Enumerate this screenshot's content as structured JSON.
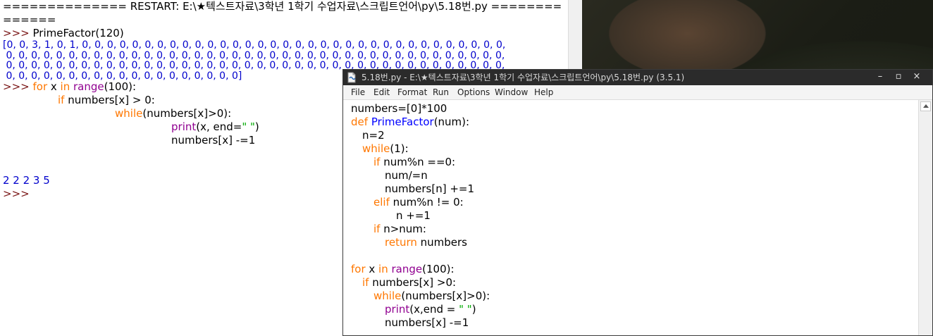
{
  "shell": {
    "restart_line": "============== RESTART: E:\\★텍스트자료\\3학년 1학기 수업자료\\스크립트언어\\py\\5.18번.py ========",
    "restart_tail": "======",
    "prompt": ">>>",
    "call": "PrimeFactor(120)",
    "list_output": [
      "[0, 0, 3, 1, 0, 1, 0, 0, 0, 0, 0, 0, 0, 0, 0, 0, 0, 0, 0, 0, 0, 0, 0, 0, 0, 0, 0, 0, 0, 0, 0, 0, 0, 0, 0, 0, 0, 0, 0, 0,",
      " 0, 0, 0, 0, 0, 0, 0, 0, 0, 0, 0, 0, 0, 0, 0, 0, 0, 0, 0, 0, 0, 0, 0, 0, 0, 0, 0, 0, 0, 0, 0, 0, 0, 0, 0, 0, 0, 0, 0, 0,",
      " 0, 0, 0, 0, 0, 0, 0, 0, 0, 0, 0, 0, 0, 0, 0, 0, 0, 0, 0, 0, 0, 0, 0, 0, 0, 0, 0, 0, 0, 0, 0, 0, 0, 0, 0, 0, 0, 0, 0, 0,",
      " 0, 0, 0, 0, 0, 0, 0, 0, 0, 0, 0, 0, 0, 0, 0, 0, 0, 0, 0]"
    ],
    "for_kw": "for",
    "for_rest_a": " x ",
    "in_kw": "in",
    "range_bi": "range",
    "for_rest_b": "(100):",
    "if_kw": "if",
    "if_rest": " numbers[x] > 0:",
    "while_kw": "while",
    "while_rest": "(numbers[x]>0):",
    "print_bi": "print",
    "print_rest_a": "(x, end=",
    "print_str": "\" \"",
    "print_rest_b": ")",
    "decrement": "numbers[x] -=1",
    "result_output": "2 2 2 3 5"
  },
  "editor": {
    "title": "5.18번.py - E:\\★텍스트자료\\3학년 1학기 수업자료\\스크립트언어\\py\\5.18번.py (3.5.1)",
    "window_buttons": {
      "minimize": "–",
      "maximize": "▫",
      "close": "×"
    },
    "menu": [
      "File",
      "Edit",
      "Format",
      "Run",
      "Options",
      "Window",
      "Help"
    ],
    "code": {
      "l1": "numbers=[0]*100",
      "l2_kw": "def",
      "l2_fn": "PrimeFactor",
      "l2_rest": "(num):",
      "l3": "n=2",
      "l4_kw": "while",
      "l4_rest": "(1):",
      "l5_kw": "if",
      "l5_rest": " num%n ==0:",
      "l6": "num/=n",
      "l7": "numbers[n] +=1",
      "l8_kw": "elif",
      "l8_rest": " num%n != 0:",
      "l9": "n +=1",
      "l10_kw": "if",
      "l10_rest": " n>num:",
      "l11_kw": "return",
      "l11_rest": " numbers",
      "l12_kw": "for",
      "l12_a": " x ",
      "l12_in": "in",
      "l12_sp": " ",
      "l12_bi": "range",
      "l12_rest": "(100):",
      "l13_kw": "if",
      "l13_rest": " numbers[x] >0:",
      "l14_kw": "while",
      "l14_rest": "(numbers[x]>0):",
      "l15_bi": "print",
      "l15_a": "(x,end = ",
      "l15_str": "\" \"",
      "l15_b": ")",
      "l16": "numbers[x] -=1"
    }
  },
  "colors": {
    "keyword": "#ff7700",
    "builtin": "#900090",
    "string": "#00aa00",
    "output": "#0000cc",
    "prompt": "#7a1616",
    "titlebar": "#2b2b2b"
  }
}
